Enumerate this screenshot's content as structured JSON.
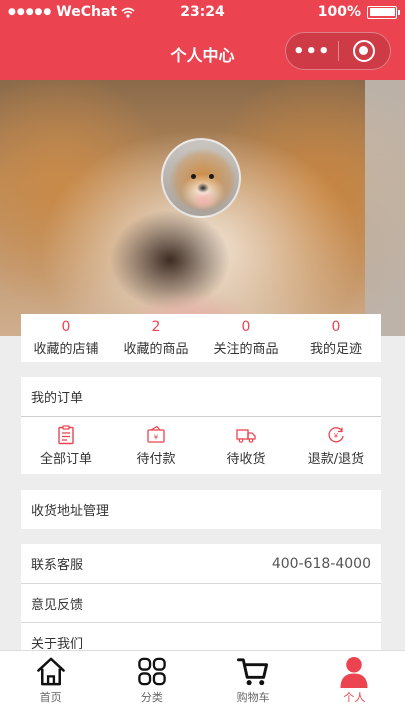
{
  "status_bar": {
    "carrier": "WeChat",
    "time": "23:24",
    "battery": "100%"
  },
  "nav": {
    "title": "个人中心",
    "more_label": "•••"
  },
  "stats": [
    {
      "count": "0",
      "label": "收藏的店铺"
    },
    {
      "count": "2",
      "label": "收藏的商品"
    },
    {
      "count": "0",
      "label": "关注的商品"
    },
    {
      "count": "0",
      "label": "我的足迹"
    }
  ],
  "orders": {
    "title": "我的订单",
    "items": [
      {
        "label": "全部订单",
        "icon": "clipboard-icon"
      },
      {
        "label": "待付款",
        "icon": "payment-icon"
      },
      {
        "label": "待收货",
        "icon": "truck-icon"
      },
      {
        "label": "退款/退货",
        "icon": "refund-icon"
      }
    ]
  },
  "address": {
    "label": "收货地址管理"
  },
  "service": {
    "contact_label": "联系客服",
    "contact_value": "400-618-4000",
    "feedback_label": "意见反馈",
    "about_label": "关于我们"
  },
  "tabbar": [
    {
      "label": "首页",
      "icon": "home-icon"
    },
    {
      "label": "分类",
      "icon": "grid-icon"
    },
    {
      "label": "购物车",
      "icon": "cart-icon"
    },
    {
      "label": "个人",
      "icon": "person-icon"
    }
  ],
  "colors": {
    "accent": "#eb4450",
    "background": "#ededed"
  }
}
